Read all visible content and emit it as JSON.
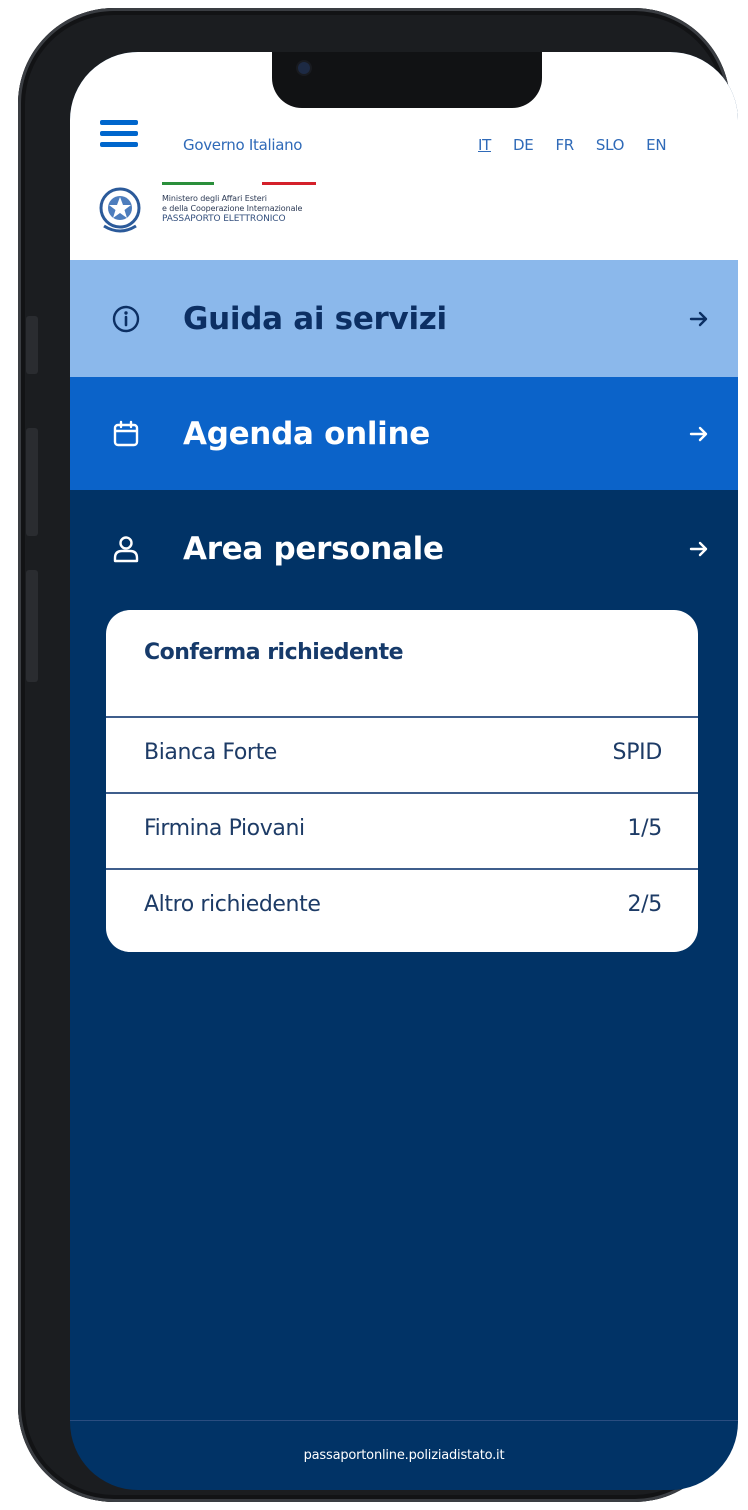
{
  "header": {
    "gov_label": "Governo Italiano",
    "languages": [
      {
        "code": "IT",
        "active": true
      },
      {
        "code": "DE",
        "active": false
      },
      {
        "code": "FR",
        "active": false
      },
      {
        "code": "SLO",
        "active": false
      },
      {
        "code": "EN",
        "active": false
      }
    ],
    "ministry_lines": [
      "Ministero degli Affari Esteri",
      "e della Cooperazione Internazionale",
      "PASSAPORTO ELETTRONICO"
    ]
  },
  "menu": [
    {
      "label": "Guida ai servizi",
      "icon": "info-circle-icon",
      "color": "#8bb8eb"
    },
    {
      "label": "Agenda online",
      "icon": "calendar-icon",
      "color": "#0b63c9"
    },
    {
      "label": "Area personale",
      "icon": "user-icon",
      "color": "#013366"
    }
  ],
  "card": {
    "title": "Conferma richiedente",
    "rows": [
      {
        "name": "Bianca Forte",
        "value": "SPID"
      },
      {
        "name": "Firmina Piovani",
        "value": "1/5"
      },
      {
        "name": "Altro richiedente",
        "value": "2/5"
      }
    ]
  },
  "footer": {
    "url": "passaportonline.poliziadistato.it"
  },
  "colors": {
    "primary": "#0066cc",
    "dark_blue": "#013366",
    "light_blue": "#8bb8eb"
  }
}
